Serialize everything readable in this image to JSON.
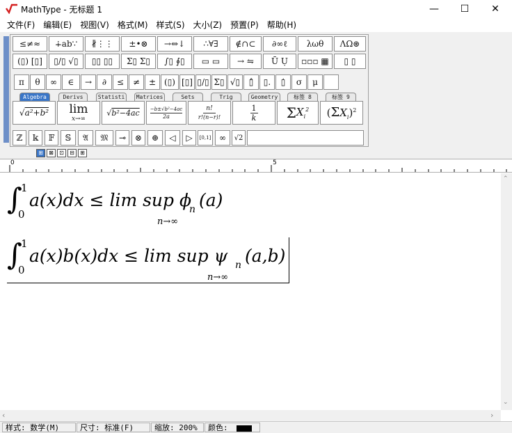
{
  "window": {
    "title": "MathType - 无标题 1",
    "minimize": "—",
    "maximize": "☐",
    "close": "✕",
    "logo_icon": "mathtype-logo-icon"
  },
  "menu": [
    "文件(F)",
    "编辑(E)",
    "视图(V)",
    "格式(M)",
    "样式(S)",
    "大小(Z)",
    "预置(P)",
    "帮助(H)"
  ],
  "palette": {
    "row1": [
      "≤≠≈",
      "∔ab∵",
      "∦⋮⋮",
      "±•⊗",
      "→⇔↓",
      "∴∀∃",
      "∉∩⊂",
      "∂∞ℓ",
      "λωθ",
      "ΛΩ⊛"
    ],
    "row2": [
      "(▯) [▯]",
      "▯/▯ √▯",
      "▯▯ ▯▯",
      "Σ▯ Σ▯",
      "∫▯ ∮▯",
      "▭ ▭",
      "→ ⇋",
      "Ū Ụ",
      "▫▫▫ ▦",
      "▯ ▯"
    ],
    "row3": [
      "π",
      "θ",
      "∞",
      "∈",
      "→",
      "∂",
      "≤",
      "≠",
      "±",
      "(▯)",
      "[▯]",
      "▯/▯",
      "Σ▯",
      "√▯",
      "▯̂",
      "▯.",
      "▯̇",
      "σ",
      "μ",
      ""
    ],
    "tabs": [
      "Algebra",
      "Derivs",
      "Statisti",
      "Matrices",
      "Sets",
      "Trig",
      "Geometry",
      "标签 8",
      "标签 9"
    ],
    "templates": [
      "√(a²+b²)",
      "lim x→∞",
      "√(b²−4ac)",
      "−b±√(b²−4ac) / 2a",
      "n! / r!(n−r)!",
      "1/k",
      "Σ Xᵢ²",
      "(Σ Xᵢ)²"
    ],
    "row5": [
      "ℤ",
      "𝕜",
      "𝔽",
      "𝕊",
      "𝔄",
      "𝔐",
      "⊸",
      "⊗",
      "⊕",
      "◁",
      "▷",
      "[0,1]",
      "∞",
      "√2"
    ],
    "small_tabs": [
      "⊞",
      "⊠",
      "⊡",
      "⊟",
      "⊞"
    ]
  },
  "ruler": {
    "mark0": "0",
    "mark5": "5"
  },
  "equations": {
    "eq1": {
      "int": "∫",
      "upper": "1",
      "lower": "0",
      "body": "a(x)dx ≤ lim sup ϕ",
      "sub": "n",
      "tail": "(a)",
      "limsub": "n→∞"
    },
    "eq2": {
      "int": "∫",
      "upper": "1",
      "lower": "0",
      "body": "a(x)b(x)dx ≤ lim sup ψ",
      "sub": "n",
      "tail": "(a,b)",
      "limsub": "n→∞"
    }
  },
  "status": {
    "style": "样式: 数学(M)",
    "size": "尺寸: 标准(F)",
    "zoom": "缩放: 200%",
    "color": "颜色:",
    "color_value": "#000000"
  }
}
